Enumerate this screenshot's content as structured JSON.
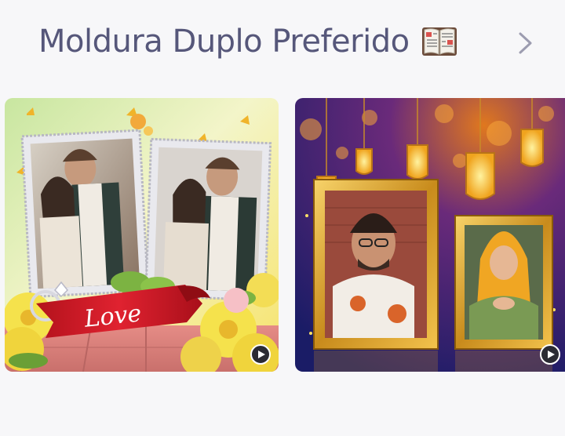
{
  "section": {
    "title": "Moldura Duplo Preferido",
    "title_emoji_icon": "open-book-icon",
    "more_icon": "chevron-right-icon"
  },
  "cards": [
    {
      "id": "love-double-frame",
      "banner_text": "Love",
      "play_icon": "play-circle-icon"
    },
    {
      "id": "lantern-double-frame",
      "play_icon": "play-circle-icon"
    }
  ],
  "colors": {
    "background": "#f7f7f9",
    "title": "#56577a",
    "chevron": "#9c9cb0"
  }
}
